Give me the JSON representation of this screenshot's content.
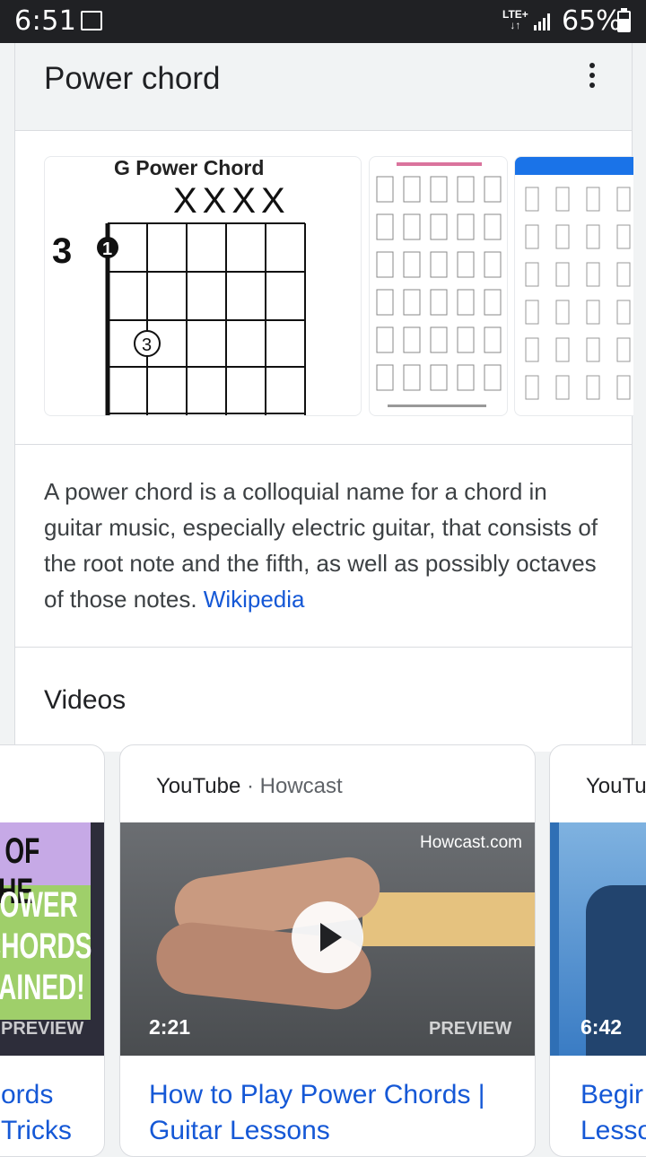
{
  "status_bar": {
    "time": "6:51",
    "network": "LTE+",
    "battery": "65%",
    "battery_level": 0.65
  },
  "header": {
    "title": "Power chord"
  },
  "images": {
    "chord_title": "G Power Chord",
    "muted_strings": "XXXX",
    "fret_number": "3",
    "finger_1": "1",
    "finger_3": "3"
  },
  "description": {
    "text": "A power chord is a colloquial name for a chord in guitar music, especially electric guitar, that consists of the root note and the fifth, as well as possibly octaves of those notes. ",
    "link": "Wikipedia"
  },
  "videos": {
    "heading": "Videos",
    "items": [
      {
        "thumb_text_1": "L OF THE",
        "thumb_text_2": "POWER",
        "thumb_text_3": "CHORDS",
        "thumb_text_4": "LAINED!",
        "preview": "PREVIEW",
        "title_line1": "ords",
        "title_line2": "Tricks"
      },
      {
        "source": "YouTube",
        "channel": "Howcast",
        "separator": " · ",
        "logo": "Howcast.com",
        "duration": "2:21",
        "preview": "PREVIEW",
        "title_line1": "How to Play Power Chords |",
        "title_line2": "Guitar Lessons"
      },
      {
        "source": "YouTu",
        "duration": "6:42",
        "title_line1": "Begir",
        "title_line2": "Lesso"
      }
    ]
  },
  "colors": {
    "link": "#1558d6",
    "header_bg": "#f1f3f4",
    "status_bar_bg": "#202124"
  }
}
